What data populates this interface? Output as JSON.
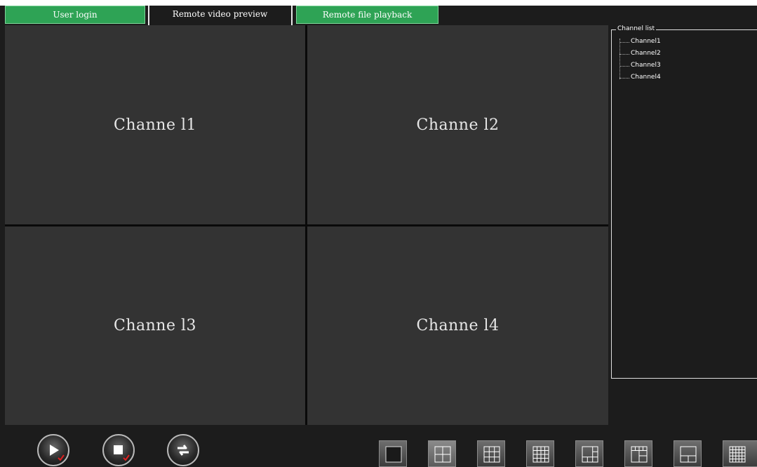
{
  "tabs": [
    {
      "label": "User login"
    },
    {
      "label": "Remote video preview"
    },
    {
      "label": "Remote file playback"
    }
  ],
  "video_grid": {
    "channels": [
      "Channe l1",
      "Channe l2",
      "Channe l3",
      "Channe l4"
    ]
  },
  "channel_list": {
    "title": "Channel list",
    "items": [
      "Channel1",
      "Channel2",
      "Channel3",
      "Channel4"
    ]
  },
  "controls": {
    "buttons": [
      {
        "icon": "play-icon"
      },
      {
        "icon": "stop-icon"
      },
      {
        "icon": "switch-icon"
      }
    ]
  },
  "layouts": {
    "selected": "4-split",
    "options": [
      "1-split",
      "4-split",
      "9-split",
      "16-split",
      "6-split",
      "8-split",
      "3-split",
      "25-split"
    ]
  },
  "colors": {
    "tab_green": "#2ea355",
    "cell_bg": "#333333",
    "background": "#1c1c1c"
  }
}
